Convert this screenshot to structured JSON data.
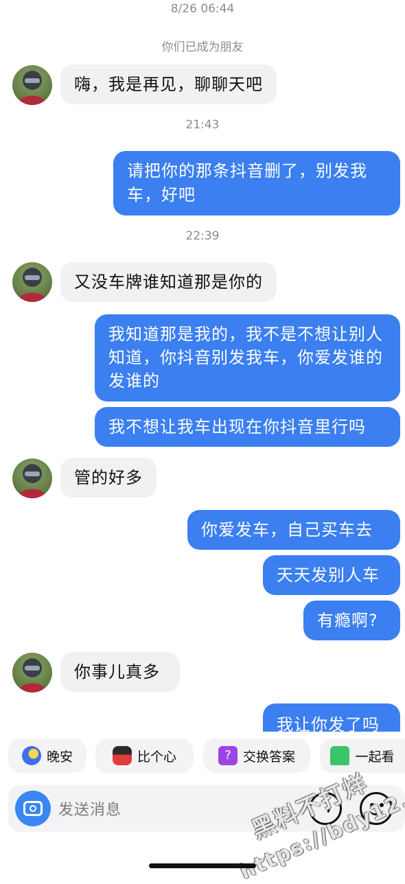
{
  "chat": {
    "timestamps": [
      "8/26 06:44",
      "21:43",
      "22:39"
    ],
    "system_notice": "你们已成为朋友",
    "messages": [
      {
        "from": "them",
        "text": "嗨，我是再见，聊聊天吧"
      },
      {
        "from": "me",
        "text": "请把你的那条抖音删了，别发我车，好吧"
      },
      {
        "from": "them",
        "text": "又没车牌谁知道那是你的"
      },
      {
        "from": "me",
        "text": "我知道那是我的，我不是不想让别人知道，你抖音别发我车，你爱发谁的发谁的"
      },
      {
        "from": "me",
        "text": "我不想让我车出现在你抖音里行吗"
      },
      {
        "from": "them",
        "text": "管的好多"
      },
      {
        "from": "me",
        "text": "你爱发车，自己买车去"
      },
      {
        "from": "me",
        "text": "天天发别人车"
      },
      {
        "from": "me",
        "text": "有瘾啊?"
      },
      {
        "from": "them",
        "text": "你事儿真多"
      },
      {
        "from": "me",
        "text": "我让你发了吗"
      }
    ]
  },
  "quick_replies": [
    {
      "label": "晚安",
      "icon": "moon-icon"
    },
    {
      "label": "比个心",
      "icon": "heart-gesture-icon"
    },
    {
      "label": "交换答案",
      "icon": "question-icon"
    },
    {
      "label": "一起看",
      "icon": "sofa-icon"
    }
  ],
  "input": {
    "placeholder": "发送消息",
    "left_icon": "camera-icon",
    "right_icons": [
      "voice-icon",
      "emoji-icon"
    ]
  },
  "watermark": {
    "line1": "黑料不打烊",
    "line2": "https://bdy12.co"
  },
  "colors": {
    "accent": "#3b7ff0",
    "incoming_bg": "#f1f1f3",
    "meta_text": "#8c8c8c"
  }
}
